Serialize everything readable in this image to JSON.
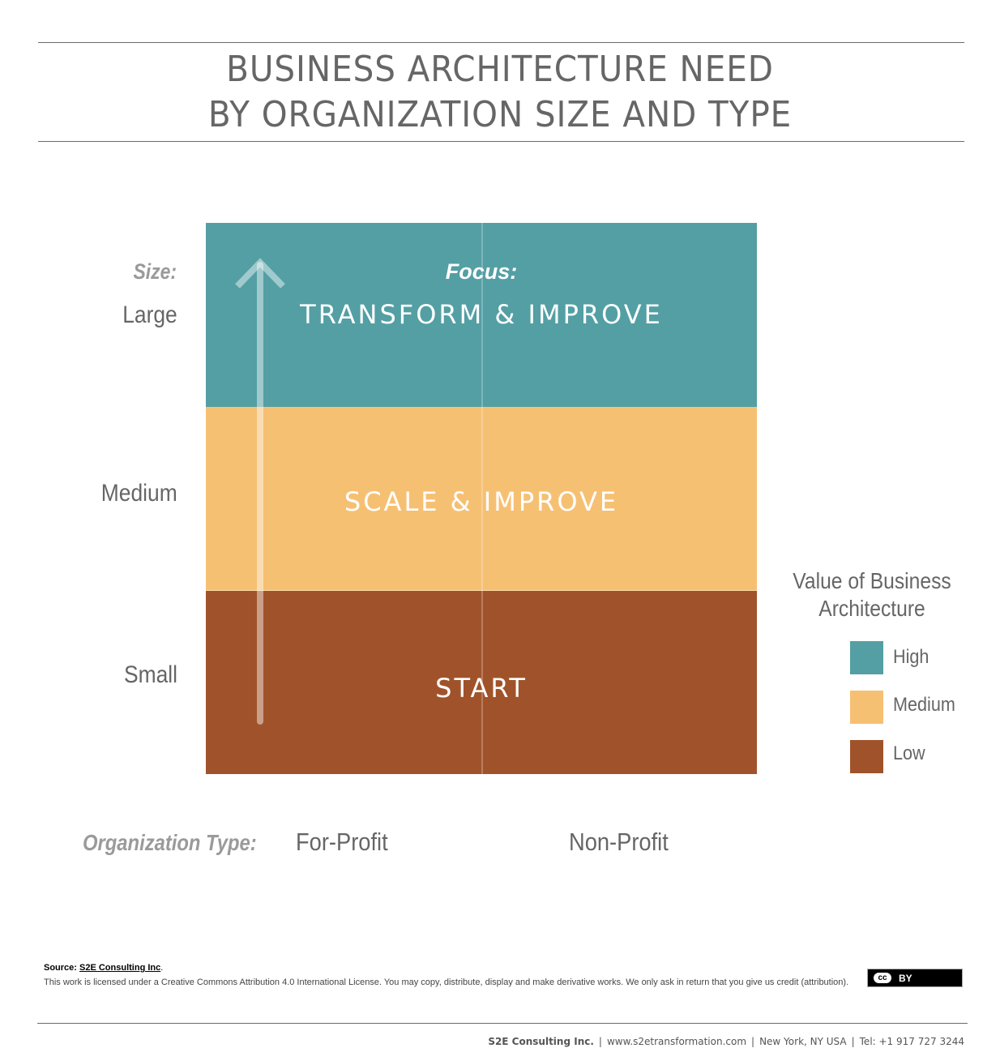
{
  "title": {
    "line1": "BUSINESS ARCHITECTURE NEED",
    "line2": "BY ORGANIZATION SIZE AND TYPE"
  },
  "chart_data": {
    "type": "table",
    "title": "Business Architecture Need by Organization Size and Type",
    "y_axis": {
      "label": "Size:",
      "categories": [
        "Large",
        "Medium",
        "Small"
      ],
      "direction": "increasing upward (arrow)"
    },
    "x_axis": {
      "label": "Organization Type:",
      "categories": [
        "For-Profit",
        "Non-Profit"
      ]
    },
    "focus_label": "Focus:",
    "bands": [
      {
        "size": "Large",
        "focus": "TRANSFORM & IMPROVE",
        "value": "High",
        "color": "#539fa4"
      },
      {
        "size": "Medium",
        "focus": "SCALE & IMPROVE",
        "value": "Medium",
        "color": "#f6c073"
      },
      {
        "size": "Small",
        "focus": "START",
        "value": "Low",
        "color": "#a0532a"
      }
    ],
    "legend": {
      "title": "Value of Business Architecture",
      "placement": "right",
      "items": [
        {
          "label": "High",
          "color": "#539fa4"
        },
        {
          "label": "Medium",
          "color": "#f6c073"
        },
        {
          "label": "Low",
          "color": "#a0532a"
        }
      ]
    }
  },
  "source": {
    "prefix": "Source: ",
    "link_text": "S2E Consulting Inc",
    "suffix": ".",
    "license_text": "This work is licensed under a Creative Commons Attribution 4.0 International License. You may copy, distribute, display and make derivative works. We only ask in return that you give us credit (attribution)."
  },
  "cc_badge": {
    "cc": "cc",
    "by": "BY"
  },
  "footer": {
    "company": "S2E Consulting Inc.",
    "website": "www.s2etransformation.com",
    "location": "New York, NY USA",
    "phone": "Tel: +1 917 727 3244",
    "separator": "|"
  }
}
